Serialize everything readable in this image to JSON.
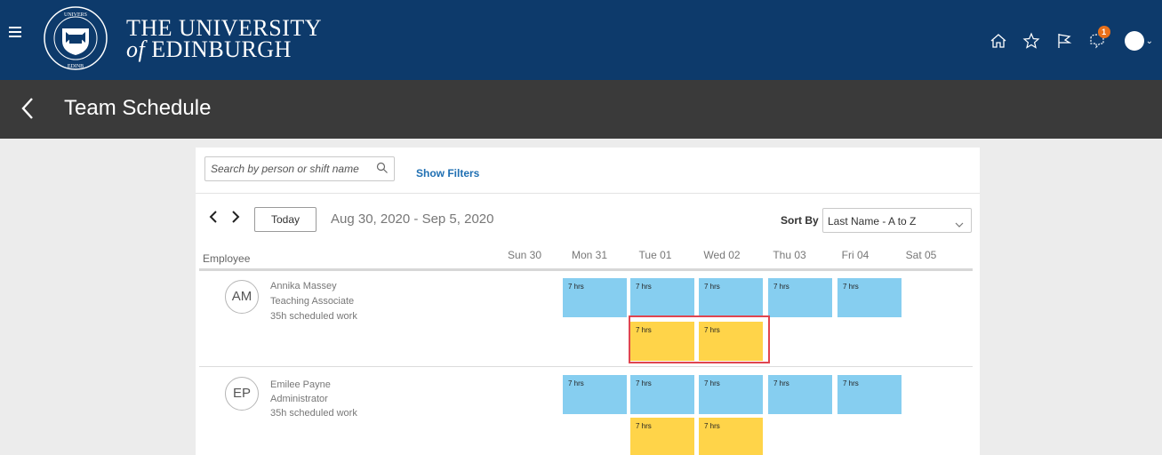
{
  "header": {
    "brand_line1": "THE UNIVERSITY",
    "brand_of": "of",
    "brand_line2": "EDINBURGH",
    "crest_text": "UNIVERSITAS EDINBURGENSIS",
    "notification_count": "1"
  },
  "subheader": {
    "title": "Team Schedule"
  },
  "toolbar": {
    "search_placeholder": "Search by person or shift name",
    "show_filters": "Show Filters",
    "today_label": "Today",
    "date_range": "Aug 30, 2020 - Sep 5, 2020",
    "sort_by_label": "Sort By",
    "sort_value": "Last Name - A to Z"
  },
  "schedule": {
    "employee_header": "Employee",
    "days": [
      "Sun 30",
      "Mon 31",
      "Tue 01",
      "Wed 02",
      "Thu 03",
      "Fri 04",
      "Sat 05"
    ],
    "employees": [
      {
        "initials": "AM",
        "name": "Annika Massey",
        "role": "Teaching Associate",
        "scheduled": "35h scheduled work",
        "shifts_row1": [
          "7 hrs",
          "7 hrs",
          "7 hrs",
          "7 hrs",
          "7 hrs"
        ],
        "shifts_row2": [
          "7 hrs",
          "7 hrs"
        ]
      },
      {
        "initials": "EP",
        "name": "Emilee Payne",
        "role": "Administrator",
        "scheduled": "35h scheduled work",
        "shifts_row1": [
          "7 hrs",
          "7 hrs",
          "7 hrs",
          "7 hrs",
          "7 hrs"
        ],
        "shifts_row2": [
          "7 hrs",
          "7 hrs"
        ]
      }
    ]
  },
  "colors": {
    "header_bg": "#0d3a6b",
    "subheader_bg": "#3a3a3a",
    "shift_blue": "#86cef0",
    "shift_yellow": "#ffd449",
    "highlight": "#e0454f",
    "link": "#1f6fb2",
    "badge": "#e8701a"
  }
}
